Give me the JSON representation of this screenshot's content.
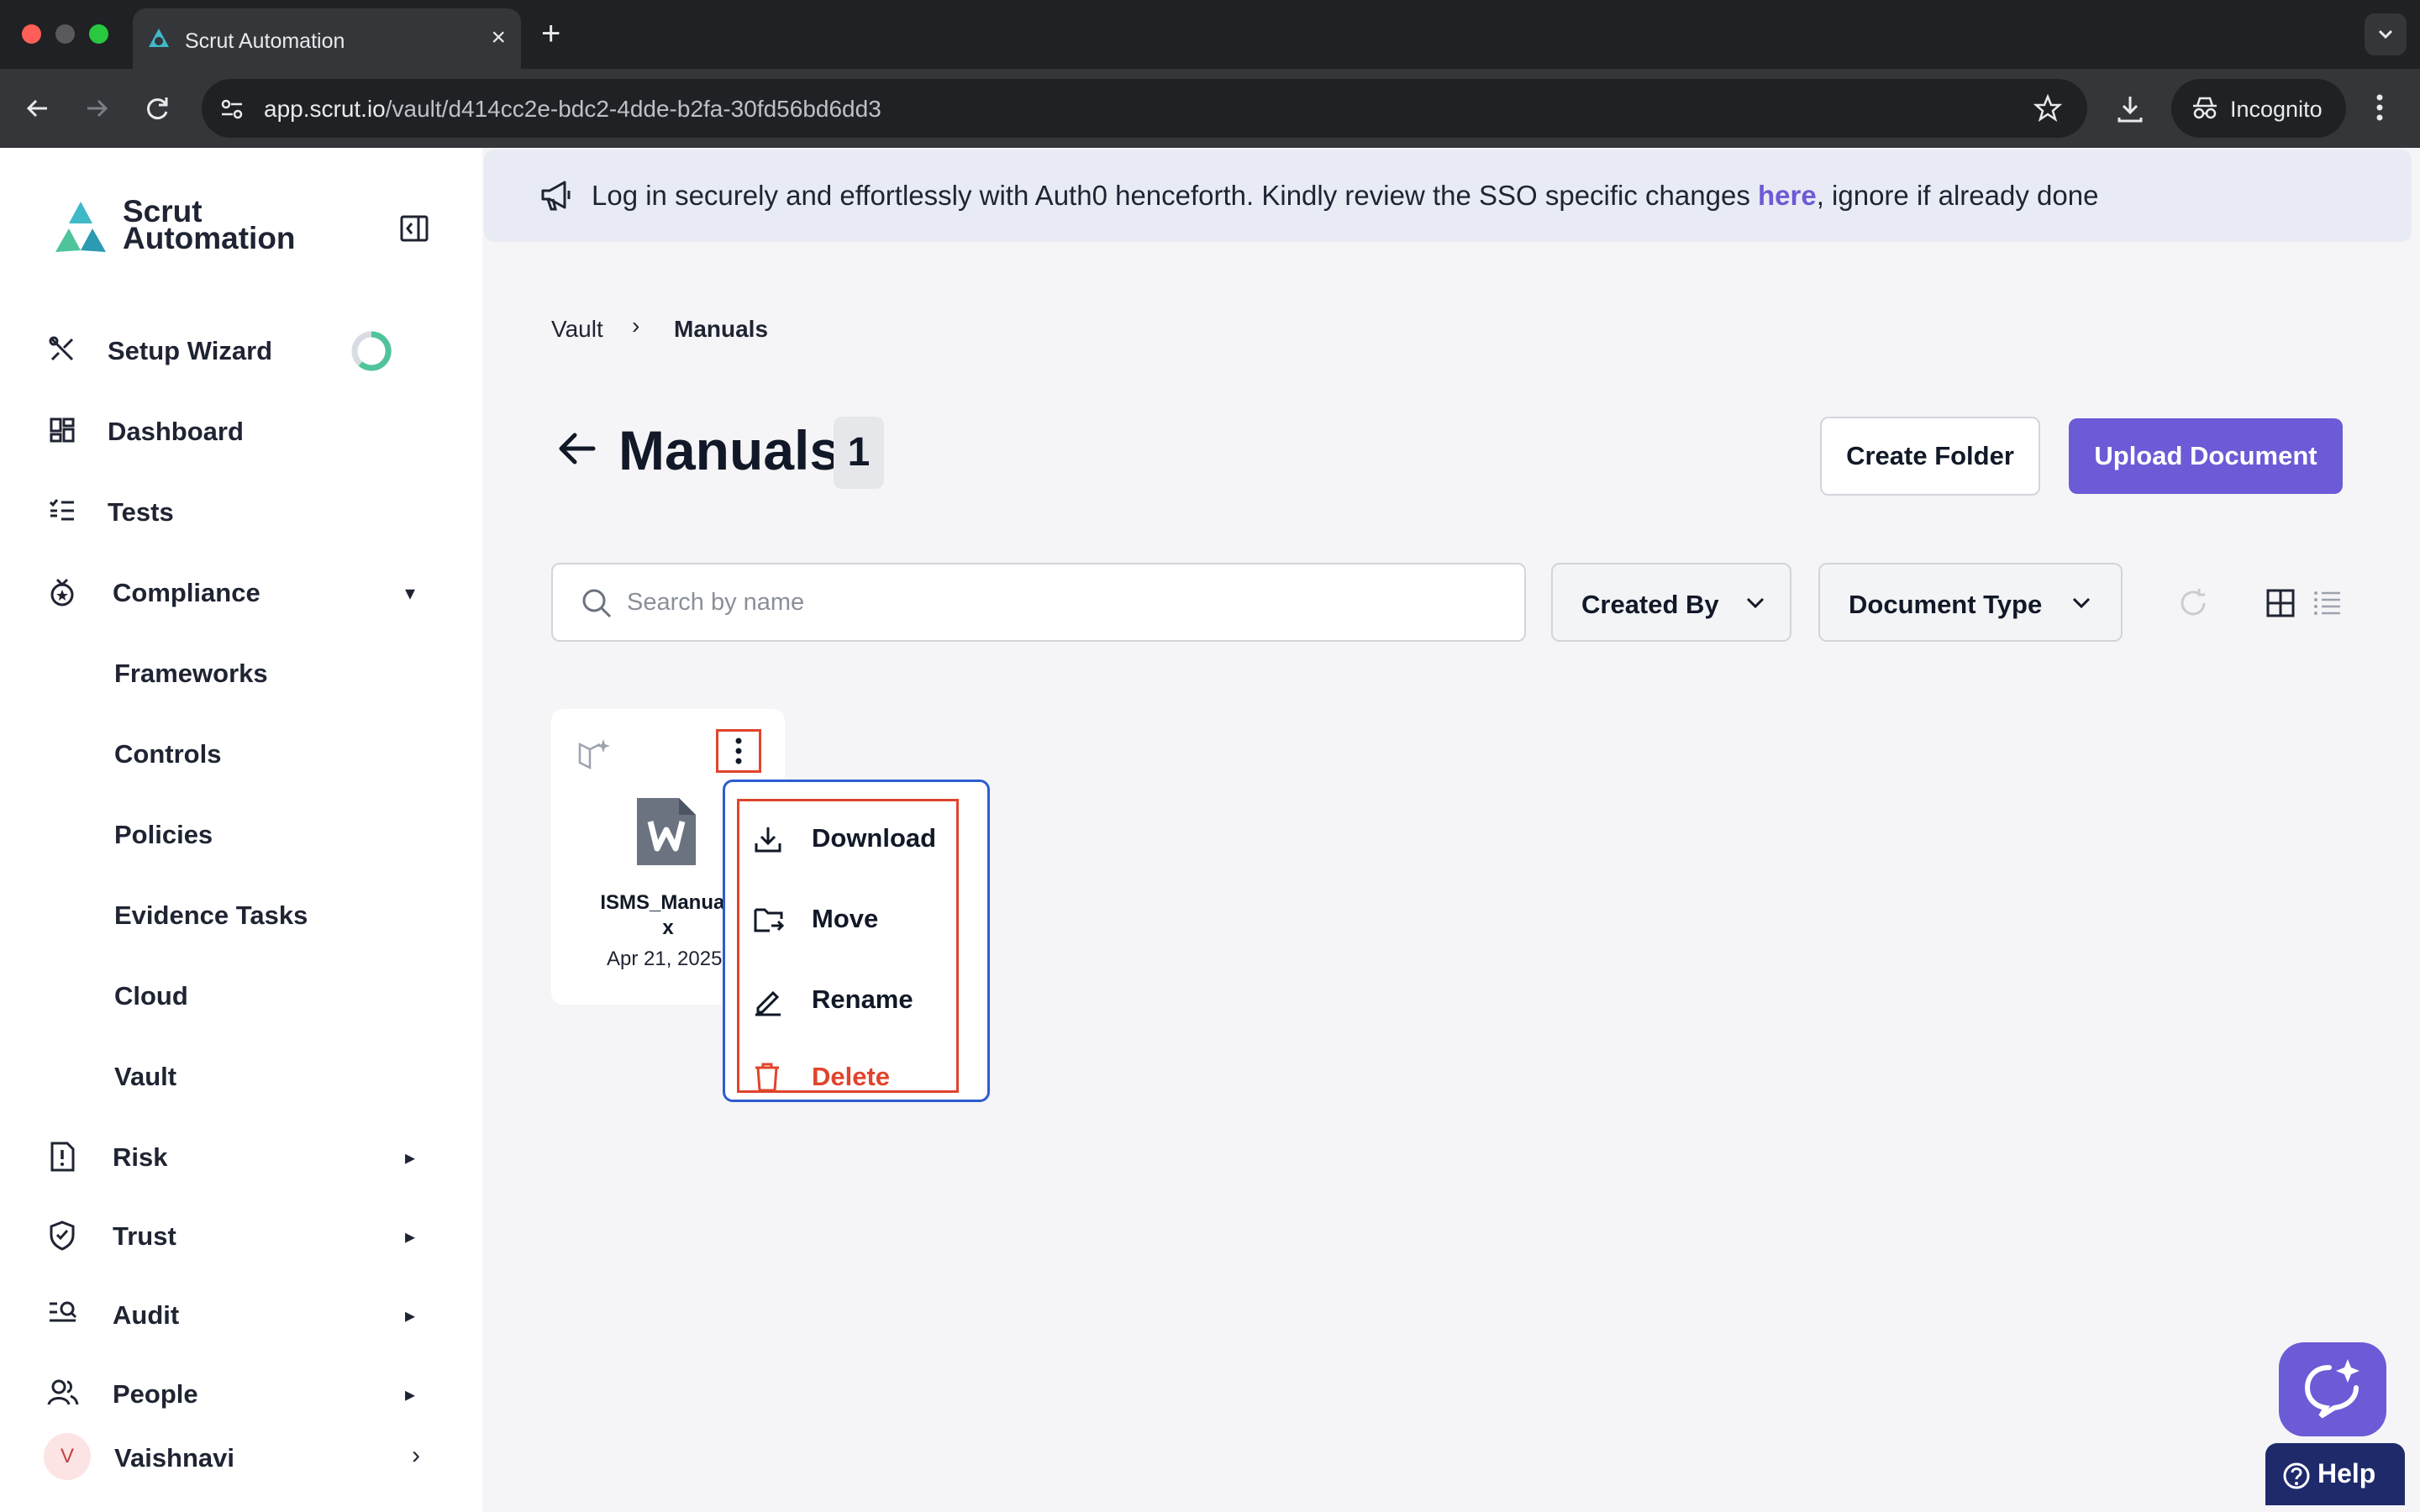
{
  "browser": {
    "tab_title": "Scrut Automation",
    "url_host": "app.scrut.io",
    "url_path": "/vault/d414cc2e-bdc2-4dde-b2fa-30fd56bd6dd3",
    "incognito_label": "Incognito"
  },
  "sidebar": {
    "logo_line1": "Scrut",
    "logo_line2": "Automation",
    "items": [
      {
        "label": "Setup Wizard",
        "icon": "wrench-cross-icon"
      },
      {
        "label": "Dashboard",
        "icon": "dashboard-icon"
      },
      {
        "label": "Tests",
        "icon": "checklist-icon"
      },
      {
        "label": "Compliance",
        "icon": "compliance-icon",
        "expanded": true
      },
      {
        "label": "Frameworks"
      },
      {
        "label": "Controls"
      },
      {
        "label": "Policies"
      },
      {
        "label": "Evidence Tasks"
      },
      {
        "label": "Cloud"
      },
      {
        "label": "Vault"
      },
      {
        "label": "Risk",
        "icon": "risk-icon"
      },
      {
        "label": "Trust",
        "icon": "shield-check-icon"
      },
      {
        "label": "Audit",
        "icon": "audit-icon"
      },
      {
        "label": "People",
        "icon": "people-icon"
      }
    ],
    "user_initial": "V",
    "user_name": "Vaishnavi"
  },
  "banner": {
    "text_before": "Log in securely and effortlessly with Auth0 henceforth. Kindly review the SSO specific changes ",
    "link": "here",
    "text_after": ", ignore if already done"
  },
  "breadcrumb": {
    "parent": "Vault",
    "separator": "›",
    "current": "Manuals"
  },
  "page": {
    "title": "Manuals",
    "count": "1",
    "create_folder": "Create Folder",
    "upload_document": "Upload Document"
  },
  "filters": {
    "search_placeholder": "Search by name",
    "created_by": "Created By",
    "document_type": "Document Type"
  },
  "card": {
    "name_line1": "ISMS_Manual.",
    "name_line2": "x",
    "date": "Apr 21, 2025"
  },
  "context_menu": {
    "items": [
      {
        "label": "Download",
        "icon": "download-icon"
      },
      {
        "label": "Move",
        "icon": "move-folder-icon"
      },
      {
        "label": "Rename",
        "icon": "pencil-icon"
      },
      {
        "label": "Delete",
        "icon": "trash-icon",
        "danger": true
      }
    ]
  },
  "help": {
    "label": "Help"
  },
  "colors": {
    "accent": "#6b5bd6",
    "danger": "#e0442c",
    "focus": "#2d5bd1"
  }
}
